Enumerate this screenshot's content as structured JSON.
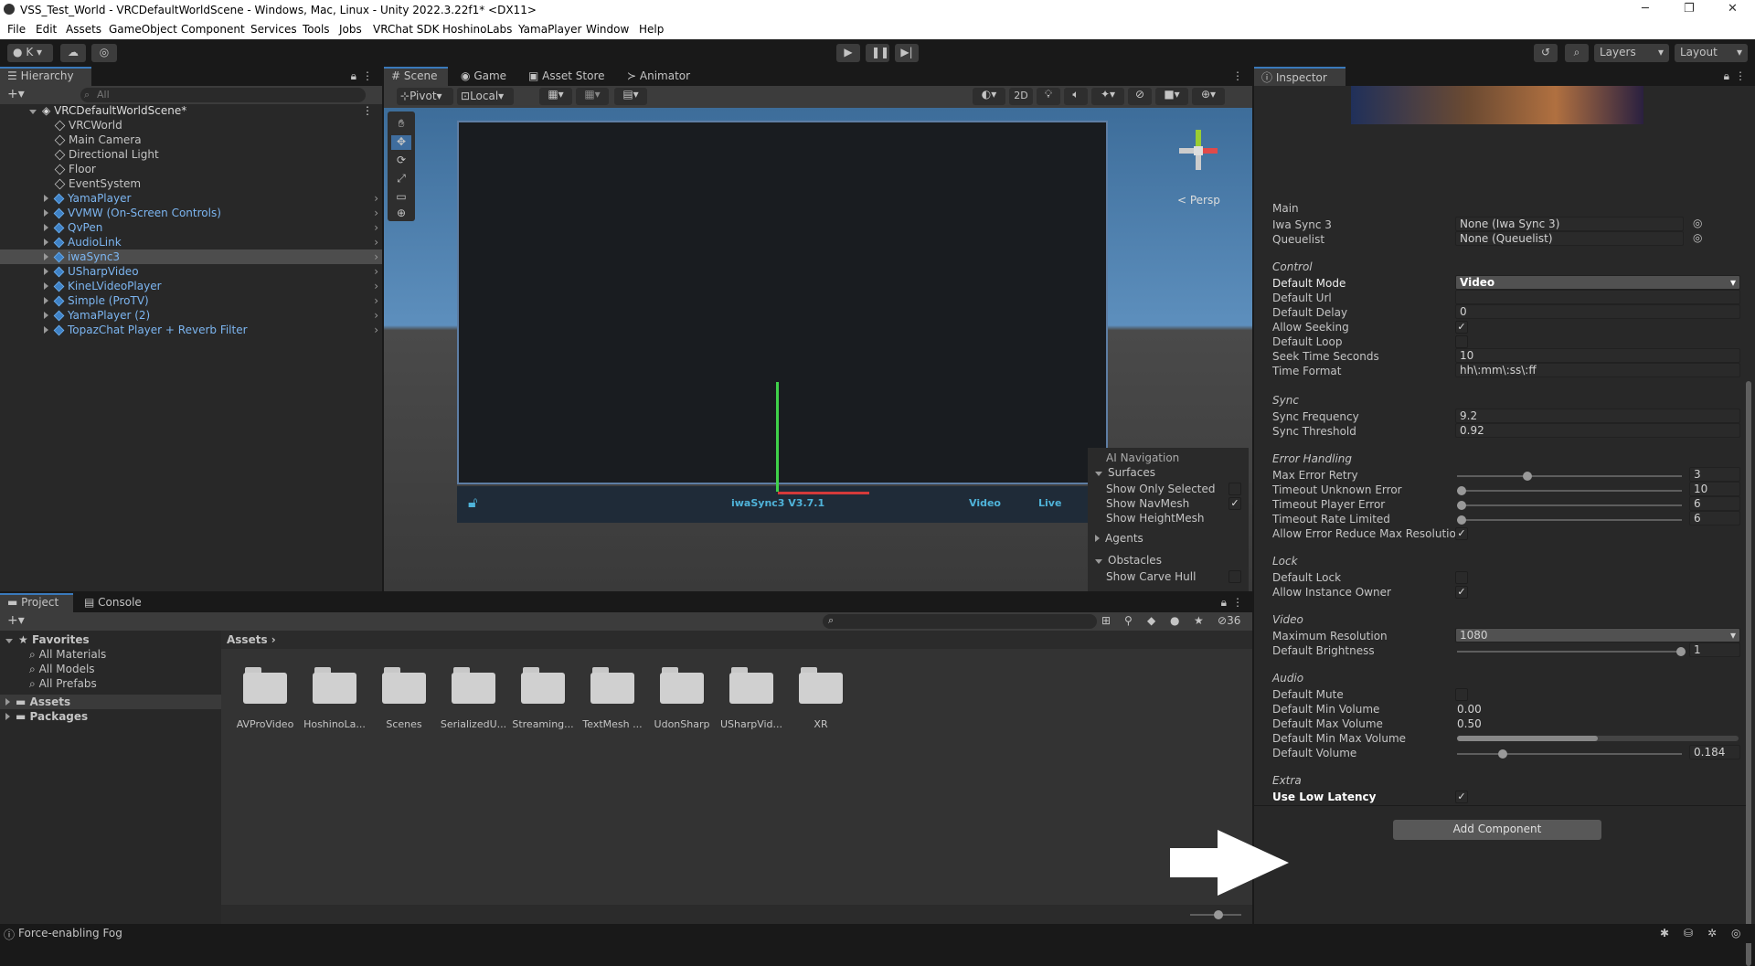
{
  "window": {
    "title": "VSS_Test_World - VRCDefaultWorldScene - Windows, Mac, Linux - Unity 2022.3.22f1* <DX11>"
  },
  "menu": [
    "File",
    "Edit",
    "Assets",
    "GameObject",
    "Component",
    "Services",
    "Tools",
    "Jobs",
    "VRChat SDK",
    "HoshinoLabs",
    "YamaPlayer",
    "Window",
    "Help"
  ],
  "toolbar": {
    "account": "K",
    "layers": "Layers",
    "layout": "Layout"
  },
  "hierarchy": {
    "tab": "Hierarchy",
    "search_placeholder": "All",
    "scene": "VRCDefaultWorldScene*",
    "items": [
      {
        "label": "VRCWorld",
        "prefab": false
      },
      {
        "label": "Main Camera",
        "prefab": false
      },
      {
        "label": "Directional Light",
        "prefab": false
      },
      {
        "label": "Floor",
        "prefab": false
      },
      {
        "label": "EventSystem",
        "prefab": false
      },
      {
        "label": "YamaPlayer",
        "prefab": true
      },
      {
        "label": "VVMW (On-Screen Controls)",
        "prefab": true
      },
      {
        "label": "QvPen",
        "prefab": true
      },
      {
        "label": "AudioLink",
        "prefab": true
      },
      {
        "label": "iwaSync3",
        "prefab": true,
        "selected": true
      },
      {
        "label": "USharpVideo",
        "prefab": true
      },
      {
        "label": "KineLVideoPlayer",
        "prefab": true
      },
      {
        "label": "Simple (ProTV)",
        "prefab": true
      },
      {
        "label": "YamaPlayer (2)",
        "prefab": true
      },
      {
        "label": "TopazChat Player + Reverb Filter",
        "prefab": true
      }
    ]
  },
  "scene_tabs": [
    "Scene",
    "Game",
    "Asset Store",
    "Animator"
  ],
  "scene_toolbar": {
    "pivot": "Pivot",
    "local": "Local",
    "mode2d": "2D"
  },
  "scene_view": {
    "persp": "< Persp",
    "player_label": "iwaSync3 V3.7.1",
    "btn_video": "Video",
    "btn_live": "Live",
    "overlay": {
      "title": "AI Navigation",
      "surfaces": "Surfaces",
      "show_only_selected": "Show Only Selected",
      "show_navmesh": "Show NavMesh",
      "show_heightmesh": "Show HeightMesh",
      "agents": "Agents",
      "obstacles": "Obstacles",
      "show_carve_hull": "Show Carve Hull"
    }
  },
  "project": {
    "tabs": [
      "Project",
      "Console"
    ],
    "favorites": "Favorites",
    "fav_items": [
      "All Materials",
      "All Models",
      "All Prefabs"
    ],
    "assets": "Assets",
    "packages": "Packages",
    "breadcrumb": "Assets",
    "hidden_count": "36",
    "folders": [
      "AVProVideo",
      "HoshinoLa...",
      "Scenes",
      "SerializedU...",
      "Streaming...",
      "TextMesh ...",
      "UdonSharp",
      "USharpVid...",
      "XR"
    ]
  },
  "inspector": {
    "tab": "Inspector",
    "sections": {
      "main": "Main",
      "control": "Control",
      "sync": "Sync",
      "error": "Error Handling",
      "lock": "Lock",
      "video": "Video",
      "audio": "Audio",
      "extra": "Extra"
    },
    "fields": {
      "iwa_sync_label": "Iwa Sync 3",
      "iwa_sync_value": "None (Iwa Sync 3)",
      "queuelist_label": "Queuelist",
      "queuelist_value": "None (Queuelist)",
      "default_mode_label": "Default Mode",
      "default_mode_value": "Video",
      "default_url_label": "Default Url",
      "default_url_value": "",
      "default_delay_label": "Default Delay",
      "default_delay_value": "0",
      "allow_seeking_label": "Allow Seeking",
      "allow_seeking": true,
      "default_loop_label": "Default Loop",
      "default_loop": false,
      "seek_time_label": "Seek Time Seconds",
      "seek_time_value": "10",
      "time_format_label": "Time Format",
      "time_format_value": "hh\\:mm\\:ss\\:ff",
      "sync_freq_label": "Sync Frequency",
      "sync_freq_value": "9.2",
      "sync_thresh_label": "Sync Threshold",
      "sync_thresh_value": "0.92",
      "max_retry_label": "Max Error Retry",
      "max_retry_value": "3",
      "timeout_unknown_label": "Timeout Unknown Error",
      "timeout_unknown_value": "10",
      "timeout_player_label": "Timeout Player Error",
      "timeout_player_value": "6",
      "timeout_rate_label": "Timeout Rate Limited",
      "timeout_rate_value": "6",
      "allow_reduce_label": "Allow Error Reduce Max Resolution",
      "allow_reduce": true,
      "default_lock_label": "Default Lock",
      "default_lock": false,
      "allow_owner_label": "Allow Instance Owner",
      "allow_owner": true,
      "max_res_label": "Maximum Resolution",
      "max_res_value": "1080",
      "brightness_label": "Default Brightness",
      "brightness_value": "1",
      "mute_label": "Default Mute",
      "mute": false,
      "min_vol_label": "Default Min Volume",
      "min_vol_value": "0.00",
      "max_vol_label": "Default Max Volume",
      "max_vol_value": "0.50",
      "minmax_vol_label": "Default Min Max Volume",
      "volume_label": "Default Volume",
      "volume_value": "0.184",
      "low_latency_label": "Use Low Latency",
      "low_latency": true
    },
    "add_component": "Add Component"
  },
  "status": {
    "message": "Force-enabling Fog"
  }
}
